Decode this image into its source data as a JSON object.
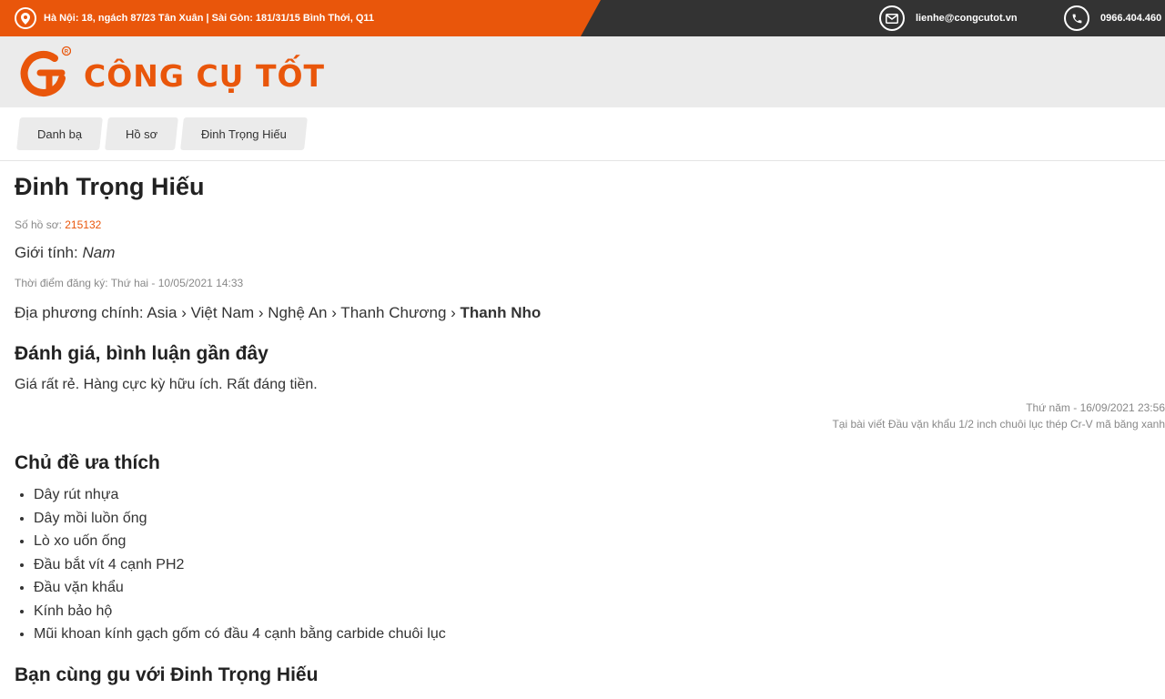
{
  "topbar": {
    "address": "Hà Nội: 18, ngách 87/23 Tân Xuân | Sài Gòn: 181/31/15 Bình Thới, Q11",
    "email": "lienhe@congcutot.vn",
    "phone": "0966.404.460"
  },
  "header": {
    "brand": "CÔNG CỤ TỐT"
  },
  "breadcrumb": [
    "Danh bạ",
    "Hồ sơ",
    "Đinh Trọng Hiếu"
  ],
  "profile": {
    "name": "Đinh Trọng Hiếu",
    "record_label": "Số hồ sơ:",
    "record_number": "215132",
    "gender_label": "Giới tính:",
    "gender": "Nam",
    "registered": "Thời điểm đăng ký: Thứ hai - 10/05/2021 14:33",
    "location_label": "Địa phương chính: Asia › Việt Nam › Nghệ An › Thanh Chương ›",
    "location_last": "Thanh Nho"
  },
  "reviews": {
    "heading": "Đánh giá, bình luận gần đây",
    "items": [
      {
        "text": "Giá rất rẻ. Hàng cực kỳ hữu ích. Rất đáng tiền.",
        "time": "Thứ năm - 16/09/2021 23:56",
        "source": "Tại bài viết Đầu vặn khẩu 1/2 inch chuôi lục thép Cr-V mã băng xanh"
      }
    ]
  },
  "topics": {
    "heading": "Chủ đề ưa thích",
    "items": [
      "Dây rút nhựa",
      "Dây mồi luồn ống",
      "Lò xo uốn ống",
      "Đầu bắt vít 4 cạnh PH2",
      "Đầu vặn khẩu",
      "Kính bảo hộ",
      "Mũi khoan kính gạch gốm có đầu 4 cạnh bằng carbide chuôi lục"
    ]
  },
  "similar": {
    "heading": "Bạn cùng gu với Đinh Trọng Hiếu"
  },
  "colors": {
    "accent": "#e9560b",
    "topbar": "#333333",
    "header": "#ebebeb"
  }
}
